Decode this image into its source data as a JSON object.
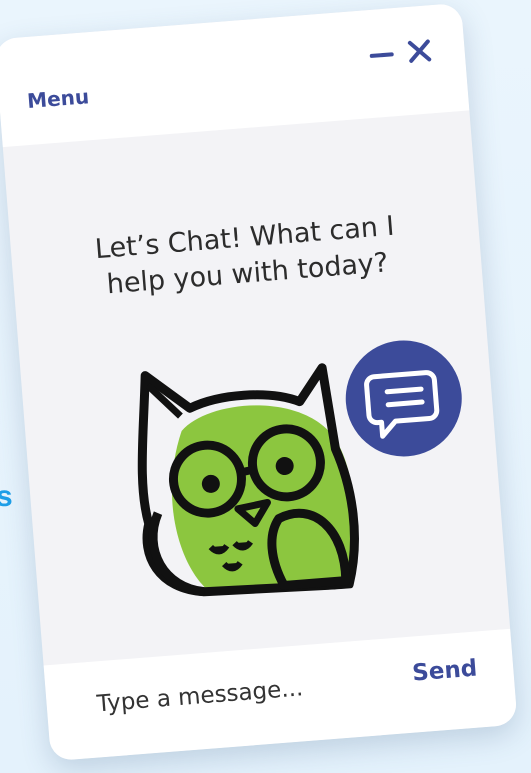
{
  "background": {
    "fragment_text": "s"
  },
  "header": {
    "menu_label": "Menu",
    "minimize_icon": "minimize-icon",
    "close_icon": "close-icon"
  },
  "chat": {
    "prompt_line1": "Let’s Chat! What can I",
    "prompt_line2": "help you with today?",
    "mascot": "owl-mascot",
    "bubble_icon": "chat-bubble-icon"
  },
  "composer": {
    "placeholder": "Type a message...",
    "send_label": "Send"
  },
  "colors": {
    "accent": "#3c4b9a",
    "owl_green": "#8cc63f",
    "bubble": "#3c4b9a",
    "card_body": "#f3f3f6",
    "page_bg": "#e6f3fc",
    "fragment": "#1e9fe8"
  }
}
